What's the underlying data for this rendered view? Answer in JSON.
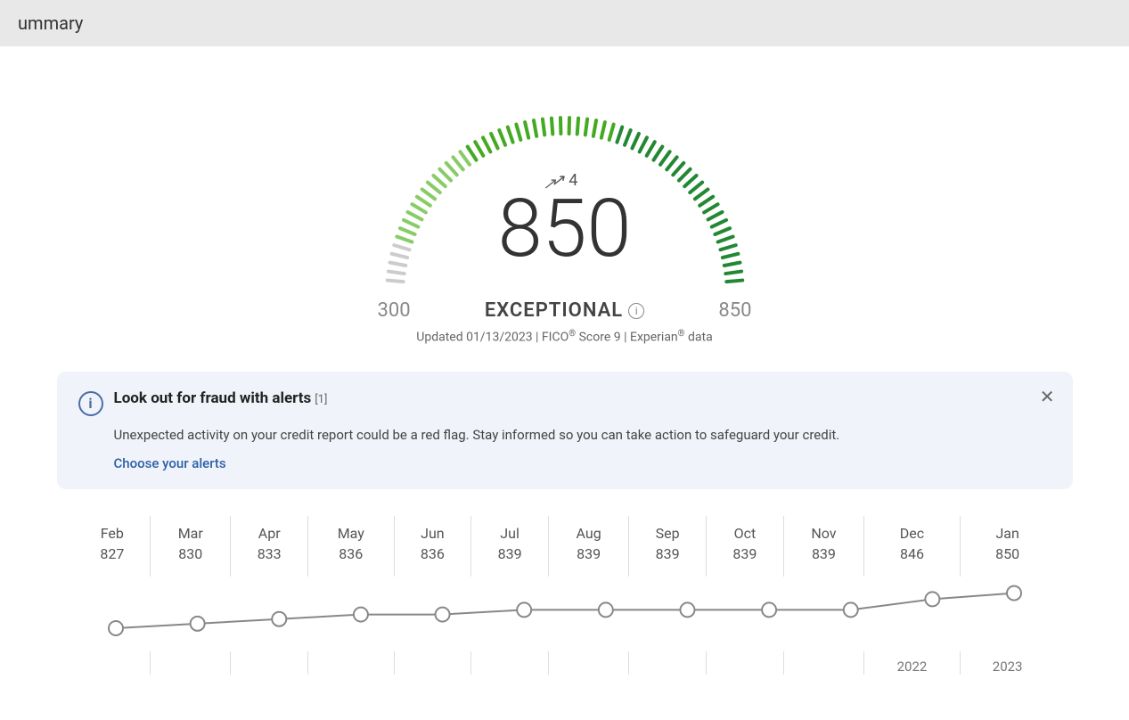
{
  "header": {
    "title": "ummary"
  },
  "score": {
    "change_arrow": "↗",
    "change_value": "4",
    "value": "850",
    "label": "EXCEPTIONAL",
    "range_low": "300",
    "range_high": "850",
    "updated_text": "Updated 01/13/2023 | FICO",
    "fico_reg": "®",
    "score_type": "Score 9",
    "provider": "Experian",
    "exp_reg": "®",
    "data_label": "data"
  },
  "alert": {
    "title": "Look out for fraud with alerts",
    "footnote": "[1]",
    "body": "Unexpected activity on your credit report could be a red flag. Stay informed so you can take action to safeguard your credit.",
    "link_label": "Choose your alerts"
  },
  "chart": {
    "months": [
      "Feb",
      "Mar",
      "Apr",
      "May",
      "Jun",
      "Jul",
      "Aug",
      "Sep",
      "Oct",
      "Nov",
      "Dec",
      "Jan"
    ],
    "scores": [
      "827",
      "830",
      "833",
      "836",
      "836",
      "839",
      "839",
      "839",
      "839",
      "839",
      "846",
      "850"
    ],
    "years": {
      "2022": 10,
      "2023": 11
    },
    "year_labels": [
      "",
      "",
      "",
      "",
      "",
      "",
      "",
      "",
      "",
      "",
      "2022",
      "2023"
    ]
  }
}
